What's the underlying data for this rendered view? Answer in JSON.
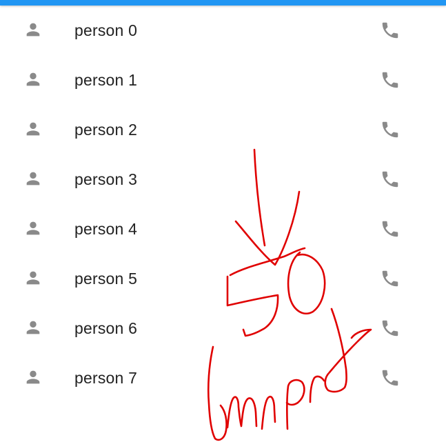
{
  "app_bar": {
    "accent_color": "#2196f3"
  },
  "contacts": [
    {
      "label": "person 0",
      "leading_icon": "person-icon",
      "trailing_icon": "phone-icon"
    },
    {
      "label": "person 1",
      "leading_icon": "person-icon",
      "trailing_icon": "phone-icon"
    },
    {
      "label": "person 2",
      "leading_icon": "person-icon",
      "trailing_icon": "phone-icon"
    },
    {
      "label": "person 3",
      "leading_icon": "person-icon",
      "trailing_icon": "phone-icon"
    },
    {
      "label": "person 4",
      "leading_icon": "person-icon",
      "trailing_icon": "phone-icon"
    },
    {
      "label": "person 5",
      "leading_icon": "person-icon",
      "trailing_icon": "phone-icon"
    },
    {
      "label": "person 6",
      "leading_icon": "person-icon",
      "trailing_icon": "phone-icon"
    },
    {
      "label": "person 7",
      "leading_icon": "person-icon",
      "trailing_icon": "phone-icon"
    }
  ],
  "colors": {
    "icon": "#8a8a8a",
    "text": "#222222",
    "annotation": "#e00000"
  },
  "handwritten_annotation": {
    "text": "50 import",
    "color": "#e00000"
  }
}
